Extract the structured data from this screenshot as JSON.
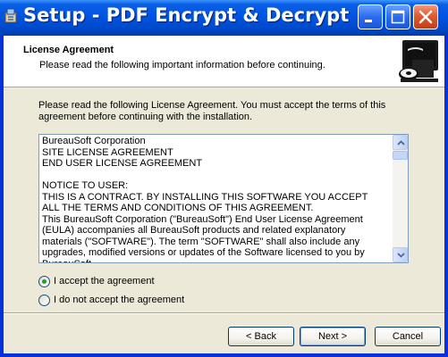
{
  "window": {
    "title": "Setup - PDF Encrypt & Decrypt"
  },
  "header": {
    "title": "License Agreement",
    "subtitle": "Please read the following important information before continuing."
  },
  "instructions": "Please read the following License Agreement. You must accept the terms of this agreement before continuing with the installation.",
  "license": {
    "text": "BureauSoft Corporation\nSITE LICENSE AGREEMENT\nEND USER LICENSE AGREEMENT\n\nNOTICE TO USER:\nTHIS IS A CONTRACT. BY INSTALLING THIS SOFTWARE YOU ACCEPT ALL THE TERMS AND CONDITIONS OF THIS AGREEMENT.\nThis BureauSoft Corporation (\"BureauSoft\") End User License Agreement (EULA) accompanies all BureauSoft products and related explanatory materials (\"SOFTWARE\"). The term \"SOFTWARE\" shall also include any upgrades, modified versions or updates of the Software licensed to you by BureauSoft."
  },
  "options": {
    "accept": {
      "label": "I accept the agreement",
      "checked": true
    },
    "decline": {
      "label": "I do not accept the agreement",
      "checked": false
    }
  },
  "buttons": {
    "back": "< Back",
    "next": "Next >",
    "cancel": "Cancel"
  },
  "colors": {
    "title_bar": "#0054e3",
    "dialog_bg": "#ece9d8",
    "radio_dot": "#21a121"
  }
}
